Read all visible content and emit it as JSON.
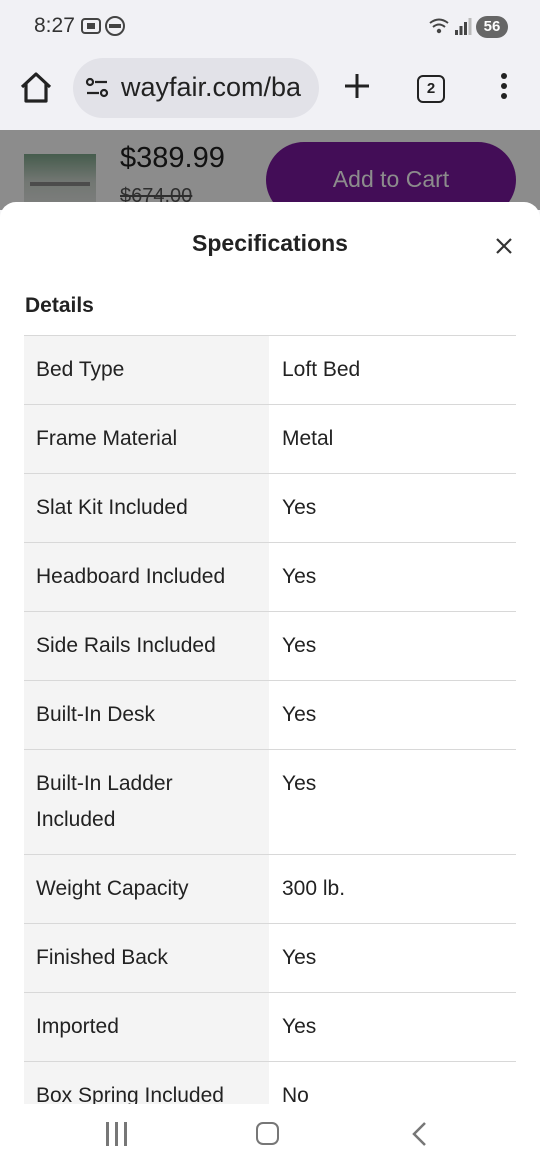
{
  "status_bar": {
    "time": "8:27",
    "battery": "56"
  },
  "browser": {
    "url": "wayfair.com/ba",
    "tab_count": "2"
  },
  "product_bar": {
    "price": "$389.99",
    "old_price": "$674.00",
    "add_to_cart_label": "Add to Cart"
  },
  "sheet": {
    "title": "Specifications",
    "section_title": "Details",
    "rows": [
      {
        "key": "Bed Type",
        "value": "Loft Bed"
      },
      {
        "key": "Frame Material",
        "value": "Metal"
      },
      {
        "key": "Slat Kit Included",
        "value": "Yes"
      },
      {
        "key": "Headboard Included",
        "value": "Yes"
      },
      {
        "key": "Side Rails Included",
        "value": "Yes"
      },
      {
        "key": "Built-In Desk",
        "value": "Yes"
      },
      {
        "key": "Built-In Ladder Included",
        "value": "Yes"
      },
      {
        "key": "Weight Capacity",
        "value": "300 lb."
      },
      {
        "key": "Finished Back",
        "value": "Yes"
      },
      {
        "key": "Imported",
        "value": "Yes"
      },
      {
        "key": "Box Spring Included",
        "value": "No"
      }
    ]
  },
  "icons": [
    "home-icon",
    "site-settings-icon",
    "plus-icon",
    "tabs-icon",
    "more-icon",
    "close-icon",
    "recents-icon",
    "home-nav-icon",
    "back-icon"
  ],
  "colors": {
    "accent": "#7b189f"
  }
}
